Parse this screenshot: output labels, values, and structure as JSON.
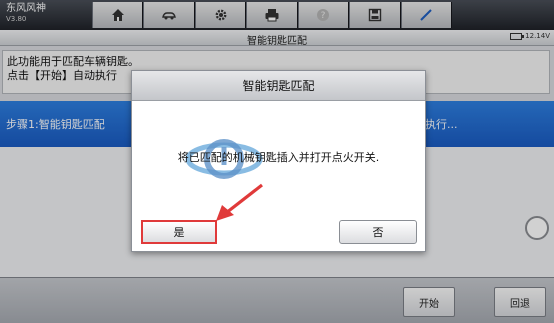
{
  "app": {
    "brand": "东风风神",
    "version": "V3.80"
  },
  "toolbar": {
    "tools": [
      {
        "name": "home-icon"
      },
      {
        "name": "car-icon"
      },
      {
        "name": "gear-icon"
      },
      {
        "name": "printer-icon"
      },
      {
        "name": "help-icon"
      },
      {
        "name": "save-icon"
      },
      {
        "name": "pen-icon"
      }
    ]
  },
  "header": {
    "title": "智能钥匙匹配",
    "battery": "12.14V"
  },
  "info": {
    "line1": "此功能用于匹配车辆钥匙。",
    "line2": "点击【开始】自动执行"
  },
  "step": {
    "label": "步骤1:智能钥匙匹配",
    "status": "执行..."
  },
  "dialog": {
    "title": "智能钥匙匹配",
    "message": "将已匹配的机械钥匙插入并打开点火开关.",
    "yes": "是",
    "no": "否"
  },
  "footer": {
    "start": "开始",
    "back": "回退"
  },
  "colors": {
    "step_bar": "#1a5bc2",
    "highlight": "#e03a3a"
  }
}
